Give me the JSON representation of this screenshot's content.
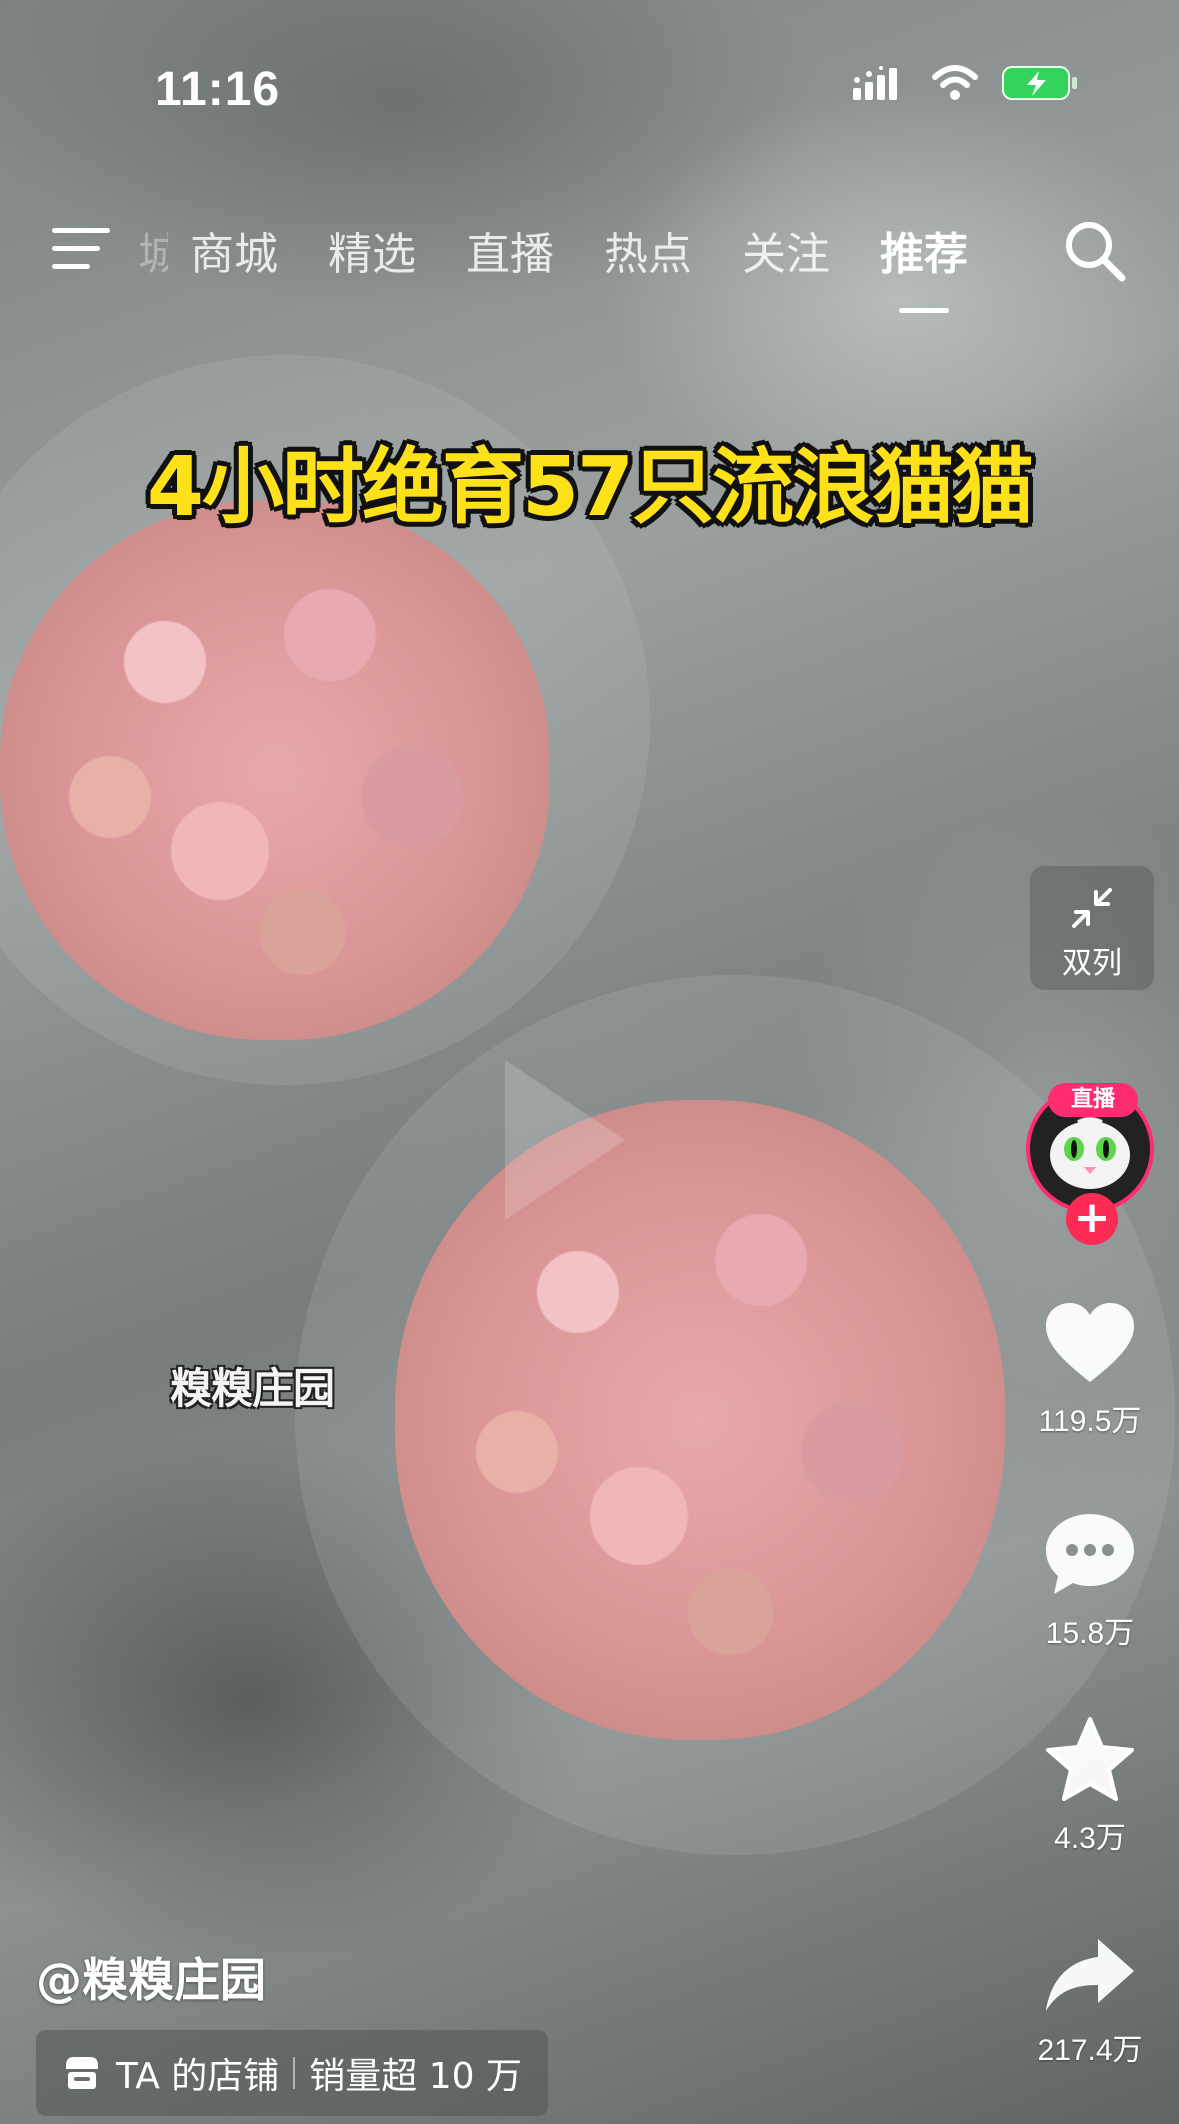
{
  "status_bar": {
    "time": "11:16"
  },
  "top_nav": {
    "partial_tab": "城",
    "tabs": [
      {
        "label": "商城",
        "active": false
      },
      {
        "label": "精选",
        "active": false
      },
      {
        "label": "直播",
        "active": false
      },
      {
        "label": "热点",
        "active": false
      },
      {
        "label": "关注",
        "active": false
      },
      {
        "label": "推荐",
        "active": true
      }
    ]
  },
  "video": {
    "title_caption": "4小时绝育57只流浪猫猫",
    "watermark": "糗糗庄园"
  },
  "right_rail": {
    "dual_column_label": "双列",
    "live_badge": "直播",
    "follow_symbol": "+",
    "likes": "119.5万",
    "comments": "15.8万",
    "favorites": "4.3万",
    "shares": "217.4万"
  },
  "bottom": {
    "author": "@糗糗庄园",
    "shop_label": "TA 的店铺",
    "sales_label": "销量超 10 万"
  },
  "colors": {
    "caption_yellow": "#ffe11a",
    "accent_pink": "#fe2c55",
    "battery_green": "#33d35c"
  }
}
